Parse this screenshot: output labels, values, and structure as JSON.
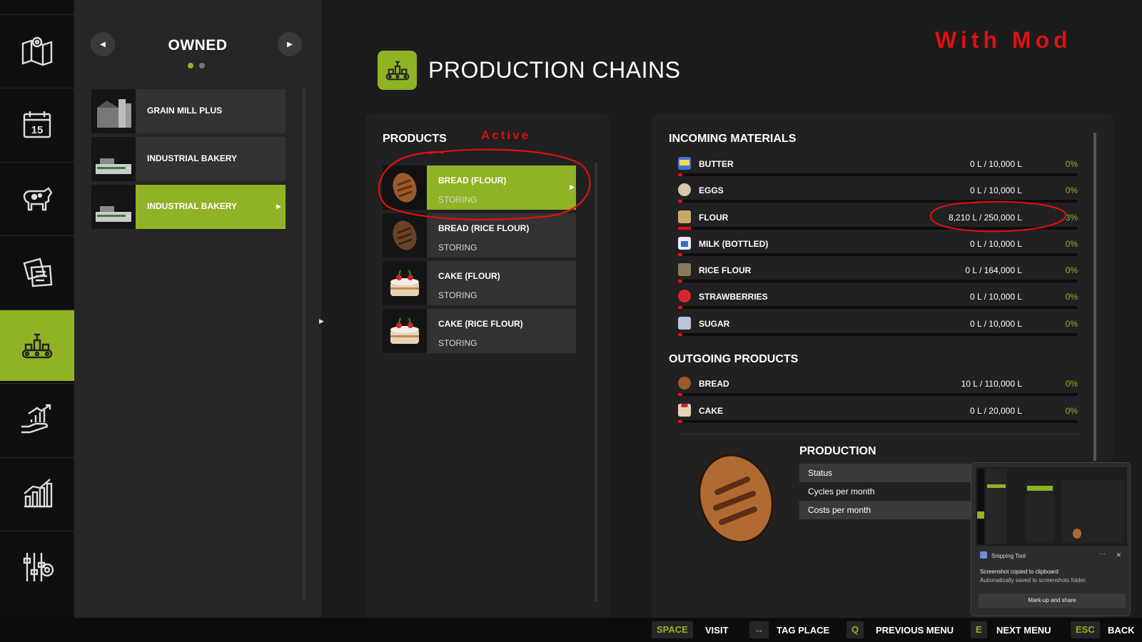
{
  "sidebar": {
    "items": [
      {
        "icon": "map-icon"
      },
      {
        "icon": "calendar-icon",
        "text": "15"
      },
      {
        "icon": "cow-icon"
      },
      {
        "icon": "contracts-icon"
      },
      {
        "icon": "production-icon"
      },
      {
        "icon": "finance-hand-icon"
      },
      {
        "icon": "statistics-icon"
      },
      {
        "icon": "settings-icon"
      }
    ],
    "active": "production-icon"
  },
  "owned": {
    "title": "OWNED",
    "items": [
      {
        "label": "GRAIN MILL PLUS"
      },
      {
        "label": "INDUSTRIAL BAKERY"
      },
      {
        "label": "INDUSTRIAL BAKERY"
      }
    ]
  },
  "header": {
    "title": "PRODUCTION CHAINS",
    "annotation": "With Mod"
  },
  "products": {
    "title": "PRODUCTS",
    "annotation": "Active",
    "items": [
      {
        "name": "BREAD (FLOUR)",
        "status": "STORING"
      },
      {
        "name": "BREAD (RICE FLOUR)",
        "status": "STORING"
      },
      {
        "name": "CAKE (FLOUR)",
        "status": "STORING"
      },
      {
        "name": "CAKE (RICE FLOUR)",
        "status": "STORING"
      }
    ]
  },
  "incoming": {
    "title": "INCOMING MATERIALS",
    "items": [
      {
        "name": "BUTTER",
        "value": "0 L / 10,000 L",
        "percent": "0%",
        "fill": 0.01
      },
      {
        "name": "EGGS",
        "value": "0 L / 10,000 L",
        "percent": "0%",
        "fill": 0.01
      },
      {
        "name": "FLOUR",
        "value": "8,210 L / 250,000 L",
        "percent": "3%",
        "fill": 0.033
      },
      {
        "name": "MILK (BOTTLED)",
        "value": "0 L / 10,000 L",
        "percent": "0%",
        "fill": 0.01
      },
      {
        "name": "RICE FLOUR",
        "value": "0 L / 164,000 L",
        "percent": "0%",
        "fill": 0.01
      },
      {
        "name": "STRAWBERRIES",
        "value": "0 L / 10,000 L",
        "percent": "0%",
        "fill": 0.01
      },
      {
        "name": "SUGAR",
        "value": "0 L / 10,000 L",
        "percent": "0%",
        "fill": 0.01
      }
    ]
  },
  "outgoing": {
    "title": "OUTGOING PRODUCTS",
    "items": [
      {
        "name": "BREAD",
        "value": "10 L / 110,000 L",
        "percent": "0%",
        "fill": 0.01
      },
      {
        "name": "CAKE",
        "value": "0 L / 20,000 L",
        "percent": "0%",
        "fill": 0.01
      }
    ]
  },
  "production": {
    "title": "PRODUCTION",
    "rows": [
      {
        "label": "Status"
      },
      {
        "label": "Cycles per month"
      },
      {
        "label": "Costs per month"
      }
    ]
  },
  "snip": {
    "app": "Snipping Tool",
    "message": "Screenshot copied to clipboard",
    "detail": "Automatically saved to screenshots folder.",
    "button": "Mark-up and share"
  },
  "bottom": {
    "actions": [
      {
        "key": "SPACE",
        "label": "VISIT"
      },
      {
        "key": "↔",
        "label": "TAG PLACE"
      },
      {
        "key": "Q",
        "label": "PREVIOUS MENU"
      },
      {
        "key": "E",
        "label": "NEXT MENU"
      },
      {
        "key": "ESC",
        "label": "BACK"
      }
    ]
  },
  "colors": {
    "accent": "#8fb325",
    "annotation": "#e01010",
    "bar_fill": "#e01010"
  }
}
